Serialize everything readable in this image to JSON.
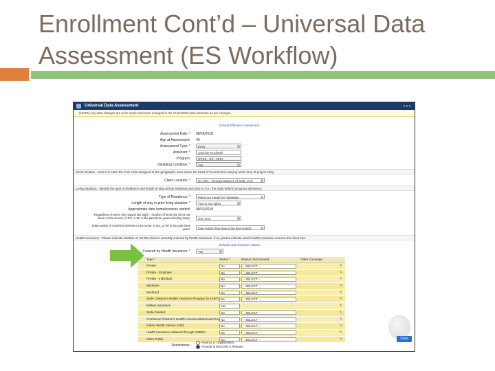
{
  "slide": {
    "title": "Enrollment Cont’d – Universal Data Assessment (ES Workflow)",
    "accent_orange": "#e0823f",
    "accent_green": "#93c47d",
    "title_color": "#7a6b5d"
  },
  "window": {
    "title": "Universal Data Assessment",
    "controls": "▪▪▪",
    "warning": "(NOTE) Any data changes are to be made whenever changed in the HUD/HMIS data elements as per changes."
  },
  "assessment": {
    "default_link": "Default Effective Assessment",
    "assessment_date_label": "Assessment Date: *",
    "assessment_date_value": "08/24/2018",
    "age_label": "Age at Assessment:",
    "age_value": "40",
    "type_label": "Assessment Type: *",
    "type_value": "Entry",
    "assessor_label": "Assessor: *",
    "assessor_value": "Jasmine Rockwell",
    "program_label": "Program:",
    "program_value": "GPSS - ES - 2017",
    "disabling_label": "Disabling Condition: *",
    "disabling_value": "Yes"
  },
  "client_location": {
    "note": "Client location - Select or enter the CoC code assigned to the geographic area where the head of household is staying at the time of project entry.",
    "label": "Client Location: *",
    "value": "GA-501 - Georgia Balance of State CoC"
  },
  "living": {
    "note": "Living Situation - Identify the type of residence and length of stay at that residence just prior to (i.e., the night before) program admission.",
    "type_label": "Type of Residence: *",
    "type_value": "Place not meant for habitation",
    "length_label": "Length of stay in prior living situation: *",
    "length_value": "Two to six nights",
    "approx_label": "Approximate date homelessness started:",
    "approx_value": "08/23/2018",
    "times_label": "Regardless of where they stayed last night – Number of times the client has been on the streets, in ES, or SH in the past three years including today:",
    "times_value": "One time",
    "months_label": "Total number of months homeless on the street, in ES, or SH in the past three years:",
    "months_value": "One month (this time is the first month)"
  },
  "health": {
    "note": "Health Insurance - Please indicate whether or not the client is currently covered by health insurance. If so, please indicate which health insurance sources the client has.",
    "default_link": "Default Last Insurance Status",
    "covered_label": "Covered by Health Insurance: *",
    "covered_value": "Yes",
    "col_type": "Type *",
    "col_status": "Status *",
    "col_reason": "Reason Not Insured",
    "col_other": "Other Coverage",
    "rows": [
      {
        "type": "Private",
        "status": "No",
        "reason": "-- SELECT --"
      },
      {
        "type": "Private - Employer",
        "status": "No",
        "reason": "-- SELECT --"
      },
      {
        "type": "Private - Individual",
        "status": "No",
        "reason": "-- SELECT --"
      },
      {
        "type": "Medicare",
        "status": "No",
        "reason": "-- SELECT --"
      },
      {
        "type": "Medicaid",
        "status": "No",
        "reason": "-- SELECT --"
      },
      {
        "type": "State Children's Health Insurance Program (S-CHIP)",
        "status": "No",
        "reason": "-- SELECT --"
      },
      {
        "type": "Military Insurance",
        "status": "Yes",
        "reason": ""
      },
      {
        "type": "State Funded",
        "status": "No",
        "reason": "-- SELECT --"
      },
      {
        "type": "Combined Children's Health Insurance/Medicaid Program",
        "status": "No",
        "reason": "-- SELECT --"
      },
      {
        "type": "Indian Health Service (IHS)",
        "status": "No",
        "reason": "-- SELECT --"
      },
      {
        "type": "Health Insurance obtained through COBRA",
        "status": "No",
        "reason": "-- SELECT --"
      },
      {
        "type": "Other Public",
        "status": "No",
        "reason": "-- SELECT --"
      }
    ]
  },
  "restrictions": {
    "label": "Restrictions:",
    "opt1": "Restrict to Organization",
    "opt2": "Provide to BeCOOL's Release"
  },
  "save_label": "Save"
}
